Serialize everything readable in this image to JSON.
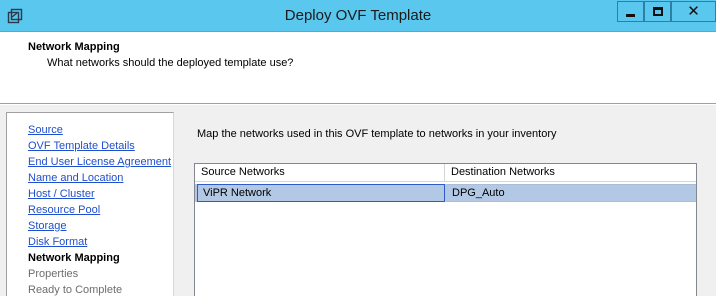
{
  "window": {
    "title": "Deploy OVF Template",
    "controls": {
      "minimize": "minimize",
      "maximize": "maximize",
      "close": "✕"
    },
    "colors": {
      "titlebar": "#5ac7ee"
    }
  },
  "header": {
    "title": "Network Mapping",
    "subtitle": "What networks should the deployed template use?"
  },
  "nav": {
    "items": [
      {
        "label": "Source",
        "state": "link"
      },
      {
        "label": "OVF Template Details",
        "state": "link"
      },
      {
        "label": "End User License Agreement",
        "state": "link"
      },
      {
        "label": "Name and Location",
        "state": "link"
      },
      {
        "label": "Host / Cluster",
        "state": "link"
      },
      {
        "label": "Resource Pool",
        "state": "link"
      },
      {
        "label": "Storage",
        "state": "link"
      },
      {
        "label": "Disk Format",
        "state": "link"
      },
      {
        "label": "Network Mapping",
        "state": "current"
      },
      {
        "label": "Properties",
        "state": "pending"
      },
      {
        "label": "Ready to Complete",
        "state": "pending"
      }
    ]
  },
  "main": {
    "description": "Map the networks used in this OVF template to networks in your inventory",
    "table": {
      "columns": [
        "Source Networks",
        "Destination Networks"
      ],
      "rows": [
        {
          "source": "ViPR Network",
          "destination": "DPG_Auto",
          "selected": true
        }
      ]
    }
  },
  "colors": {
    "link": "#1f4fcf",
    "selected_row": "#b3c8e4",
    "focus_border": "#2d5dc4"
  }
}
